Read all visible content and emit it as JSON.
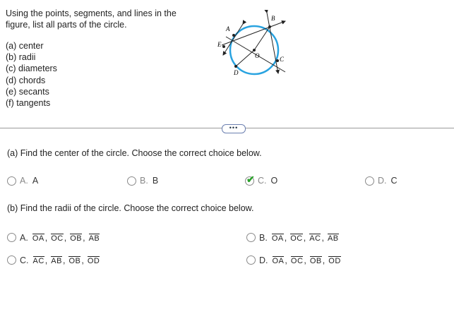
{
  "prompt": "Using the points, segments, and lines in the figure, list all parts of the circle.",
  "parts": [
    "(a) center",
    "(b) radii",
    "(c) diameters",
    "(d) chords",
    "(e) secants",
    "(f) tangents"
  ],
  "figure": {
    "labels": {
      "A": "A",
      "B": "B",
      "C": "C",
      "D": "D",
      "E": "E",
      "O": "O"
    },
    "circle_color": "#29a3e0"
  },
  "divider": {
    "more_label": "•••"
  },
  "question_a": {
    "text": "(a) Find the center of the circle. Choose the correct choice below.",
    "choices": [
      {
        "letter": "A.",
        "value": "A"
      },
      {
        "letter": "B.",
        "value": "B"
      },
      {
        "letter": "C.",
        "value": "O",
        "selected": true
      },
      {
        "letter": "D.",
        "value": "C"
      }
    ]
  },
  "question_b": {
    "text": "(b) Find the radii of the circle. Choose the correct choice below.",
    "choices": [
      {
        "letter": "A.",
        "segments": [
          "OA",
          "OC",
          "OB",
          "AB"
        ]
      },
      {
        "letter": "B.",
        "segments": [
          "OA",
          "OC",
          "AC",
          "AB"
        ]
      },
      {
        "letter": "C.",
        "segments": [
          "AC",
          "AB",
          "OB",
          "OD"
        ]
      },
      {
        "letter": "D.",
        "segments": [
          "OA",
          "OC",
          "OB",
          "OD"
        ]
      }
    ]
  },
  "colors": {
    "check": "#2aa02a",
    "circle": "#29a3e0"
  }
}
